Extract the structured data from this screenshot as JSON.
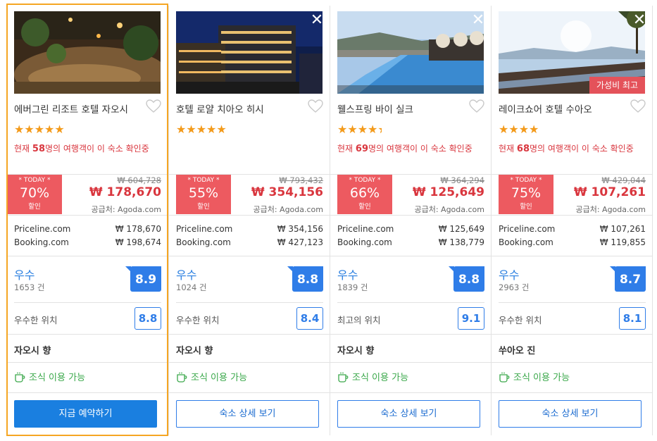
{
  "hotels": [
    {
      "name": "에버그린 리조트 호텔 자오시",
      "stars": "★★★★★",
      "viewers_prefix": "현재 ",
      "viewers_count": "58",
      "viewers_suffix": "명의 여행객이 이 숙소 확인중",
      "badge": "",
      "deal_today": "* TODAY *",
      "deal_pct": "70%",
      "deal_label": "할인",
      "orig_price": "₩ 604,728",
      "price": "₩ 178,670",
      "supplier": "공급처: Agoda.com",
      "ota": [
        {
          "name": "Priceline.com",
          "price": "₩ 178,670"
        },
        {
          "name": "Booking.com",
          "price": "₩ 198,674"
        }
      ],
      "rating_word": "우수",
      "rating_count": "1653 건",
      "score": "8.9",
      "location_label": "우수한 위치",
      "location_score": "8.8",
      "area": "자오시 향",
      "breakfast": "조식 이용 가능",
      "button": "지금 예약하기",
      "selected": true,
      "has_close": false
    },
    {
      "name": "호텔 로얄 치아오 히시",
      "stars": "★★★★★",
      "viewers_prefix": "",
      "viewers_count": "",
      "viewers_suffix": "",
      "badge": "",
      "deal_today": "* TODAY *",
      "deal_pct": "55%",
      "deal_label": "할인",
      "orig_price": "₩ 793,432",
      "price": "₩ 354,156",
      "supplier": "공급처: Agoda.com",
      "ota": [
        {
          "name": "Priceline.com",
          "price": "₩ 354,156"
        },
        {
          "name": "Booking.com",
          "price": "₩ 427,123"
        }
      ],
      "rating_word": "우수",
      "rating_count": "1024 건",
      "score": "8.8",
      "location_label": "우수한 위치",
      "location_score": "8.4",
      "area": "자오시 향",
      "breakfast": "조식 이용 가능",
      "button": "숙소 상세 보기",
      "selected": false,
      "has_close": true
    },
    {
      "name": "웰스프링 바이 실크",
      "stars": "★★★★",
      "viewers_prefix": "현재 ",
      "viewers_count": "69",
      "viewers_suffix": "명의 여행객이 이 숙소 확인중",
      "badge": "",
      "deal_today": "* TODAY *",
      "deal_pct": "66%",
      "deal_label": "할인",
      "orig_price": "₩ 364,294",
      "price": "₩ 125,649",
      "supplier": "공급처: Agoda.com",
      "ota": [
        {
          "name": "Priceline.com",
          "price": "₩ 125,649"
        },
        {
          "name": "Booking.com",
          "price": "₩ 138,779"
        }
      ],
      "rating_word": "우수",
      "rating_count": "1839 건",
      "score": "8.8",
      "location_label": "최고의 위치",
      "location_score": "9.1",
      "area": "자오시 향",
      "breakfast": "조식 이용 가능",
      "button": "숙소 상세 보기",
      "selected": false,
      "has_close": true
    },
    {
      "name": "레이크쇼어 호텔 수아오",
      "stars": "★★★★",
      "viewers_prefix": "현재 ",
      "viewers_count": "68",
      "viewers_suffix": "명의 여행객이 이 숙소 확인중",
      "badge": "가성비 최고",
      "deal_today": "* TODAY *",
      "deal_pct": "75%",
      "deal_label": "할인",
      "orig_price": "₩ 429,044",
      "price": "₩ 107,261",
      "supplier": "공급처: Agoda.com",
      "ota": [
        {
          "name": "Priceline.com",
          "price": "₩ 107,261"
        },
        {
          "name": "Booking.com",
          "price": "₩ 119,855"
        }
      ],
      "rating_word": "우수",
      "rating_count": "2963 건",
      "score": "8.7",
      "location_label": "우수한 위치",
      "location_score": "8.1",
      "area": "쑤아오 진",
      "breakfast": "조식 이용 가능",
      "button": "숙소 상세 보기",
      "selected": false,
      "has_close": true
    }
  ],
  "colors": {
    "accent_blue": "#2f7de8",
    "deal_red": "#ed5a60",
    "price_red": "#d9363e",
    "star_orange": "#f39a1a",
    "breakfast_green": "#3aa84a",
    "selected_border": "#f5a623"
  },
  "icons": {
    "close": "close-icon",
    "heart": "heart-icon",
    "breakfast": "coffee-cup-icon"
  }
}
